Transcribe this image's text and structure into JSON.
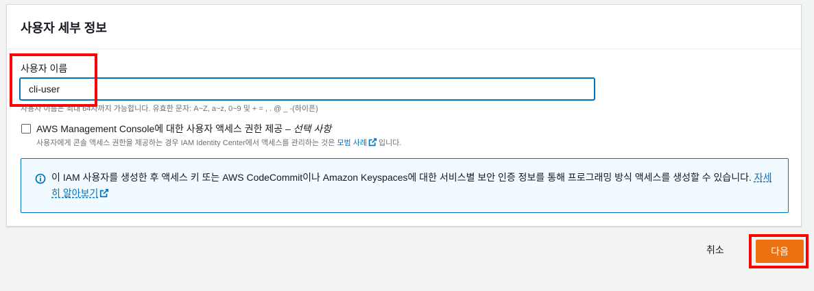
{
  "panel": {
    "title": "사용자 세부 정보"
  },
  "username_field": {
    "label": "사용자 이름",
    "value": "cli-user",
    "hint": "사용자 이름은 최대 64자까지 가능합니다. 유효한 문자: A~Z, a~z, 0~9 및 + = , . @ _ -(하이픈)"
  },
  "console_access": {
    "checked": false,
    "label": "AWS Management Console에 대한 사용자 액세스 권한 제공 – ",
    "label_optional": "선택 사항",
    "desc_prefix": "사용자에게 콘솔 액세스 권한을 제공하는 경우 IAM Identity Center에서 액세스를 관리하는 것은 ",
    "desc_link": "모범 사례",
    "desc_suffix": "입니다."
  },
  "info_alert": {
    "text": "이 IAM 사용자를 생성한 후 액세스 키 또는 AWS CodeCommit이나 Amazon Keyspaces에 대한 서비스별 보안 인증 정보를 통해 프로그래밍 방식 액세스를 생성할 수 있습니다. ",
    "link": "자세히 알아보기"
  },
  "actions": {
    "cancel_label": "취소",
    "next_label": "다음"
  },
  "colors": {
    "accent": "#0073bb",
    "primary_button": "#ec7211",
    "annotation": "#ff0000"
  }
}
